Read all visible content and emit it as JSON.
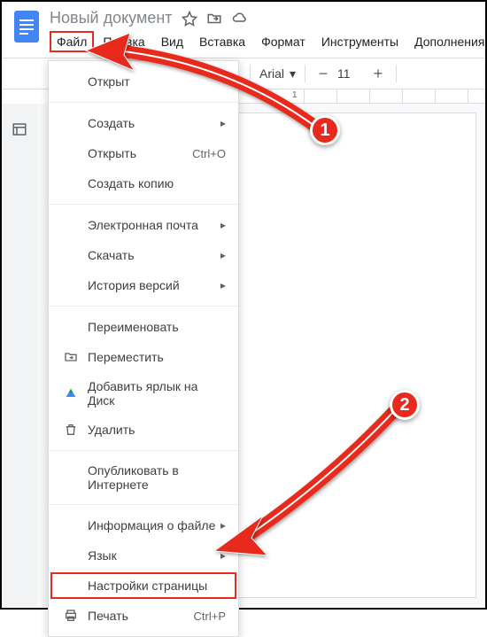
{
  "doc_title": "Новый документ",
  "menubar": {
    "file": "Файл",
    "edit": "Правка",
    "view": "Вид",
    "insert": "Вставка",
    "format": "Формат",
    "tools": "Инструменты",
    "addons": "Дополнения"
  },
  "toolbar": {
    "font": "Arial",
    "size": "11"
  },
  "dropdown": {
    "open_short": "Открыт",
    "create": "Создать",
    "open": "Открыть",
    "open_sc": "Ctrl+O",
    "copy": "Создать копию",
    "email": "Электронная почта",
    "download": "Скачать",
    "history": "История версий",
    "rename": "Переименовать",
    "move": "Переместить",
    "add_drive": "Добавить ярлык на Диск",
    "delete": "Удалить",
    "publish": "Опубликовать в Интернете",
    "info": "Информация о файле",
    "lang": "Язык",
    "page_setup": "Настройки страницы",
    "print": "Печать",
    "print_sc": "Ctrl+P"
  },
  "callouts": {
    "one": "1",
    "two": "2"
  }
}
